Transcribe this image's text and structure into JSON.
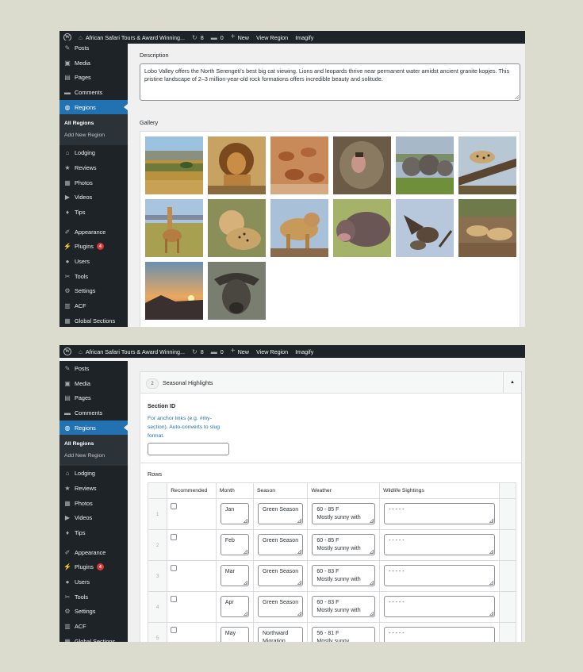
{
  "admin_bar": {
    "site_name": "African Safari Tours & Award Winning...",
    "updates_count": "8",
    "comments_count": "0",
    "new_label": "New",
    "view_label": "View Region",
    "plugin_label": "Imagify"
  },
  "sidebar": {
    "items_top": [
      {
        "label": "Posts",
        "icon": "pin-icon"
      },
      {
        "label": "Media",
        "icon": "media-icon"
      },
      {
        "label": "Pages",
        "icon": "pages-icon"
      },
      {
        "label": "Comments",
        "icon": "comment-icon"
      }
    ],
    "current": {
      "label": "Regions",
      "icon": "globe-icon"
    },
    "submenu": [
      "All Regions",
      "Add New Region"
    ],
    "items_mid": [
      {
        "label": "Lodging",
        "icon": "home-icon"
      },
      {
        "label": "Reviews",
        "icon": "star-icon"
      },
      {
        "label": "Photos",
        "icon": "photo-icon"
      },
      {
        "label": "Videos",
        "icon": "video-icon"
      },
      {
        "label": "Tips",
        "icon": "lightbulb-icon"
      }
    ],
    "items_bottom": [
      {
        "label": "Appearance",
        "icon": "brush-icon"
      },
      {
        "label": "Plugins",
        "icon": "plugin-icon",
        "badge": "4"
      },
      {
        "label": "Users",
        "icon": "user-icon"
      },
      {
        "label": "Tools",
        "icon": "wrench-icon"
      },
      {
        "label": "Settings",
        "icon": "settings-icon"
      },
      {
        "label": "ACF",
        "icon": "acf-icon"
      },
      {
        "label": "Global Sections",
        "icon": "grid-icon"
      }
    ]
  },
  "description": {
    "label": "Description",
    "text": "Lobo Valley offers the North Serengeti's best big cat viewing. Lions and leopards thrive near permanent water amidst ancient granite kopjes. This pristine landscape of 2–3 million-year-old rock formations offers incredible beauty and solitude."
  },
  "gallery": {
    "label": "Gallery",
    "images": [
      "savanna-landscape",
      "lion",
      "impala-herd",
      "baboon",
      "elephants",
      "leopard-in-tree",
      "giraffe",
      "cheetah",
      "lioness",
      "hippo",
      "vultures",
      "cheetahs-resting",
      "sunset",
      "buffalo"
    ]
  },
  "section": {
    "number": "2",
    "title": "Seasonal Highlights",
    "id_label": "Section ID",
    "id_description": "For anchor links (e.g. #my-section). Auto-converts to slug format.",
    "id_value": "",
    "rows_label": "Rows",
    "columns": [
      "Recommended",
      "Month",
      "Season",
      "Weather",
      "Wildlife Sightings"
    ],
    "rows": [
      {
        "n": "1",
        "month": "Jan",
        "season": "Green Season",
        "weather": "60 - 85 F\nMostly sunny with",
        "wildlife": "- - - - -"
      },
      {
        "n": "2",
        "month": "Feb",
        "season": "Green Season",
        "weather": "60 - 85 F\nMostly sunny with",
        "wildlife": "- - - - -"
      },
      {
        "n": "3",
        "month": "Mar",
        "season": "Green Season",
        "weather": "60 - 83 F\nMostly sunny with",
        "wildlife": "- - - - -"
      },
      {
        "n": "4",
        "month": "Apr",
        "season": "Green Season",
        "weather": "60 - 83 F\nMostly sunny with",
        "wildlife": "- - - - -"
      },
      {
        "n": "5",
        "month": "May",
        "season": "Northward\nMigration",
        "weather": "56 - 81 F\nMostly sunny",
        "wildlife": "- - - - -"
      }
    ]
  },
  "colors": {
    "accent": "#2271b1",
    "adminbar": "#1d2327",
    "badge": "#d63638"
  }
}
